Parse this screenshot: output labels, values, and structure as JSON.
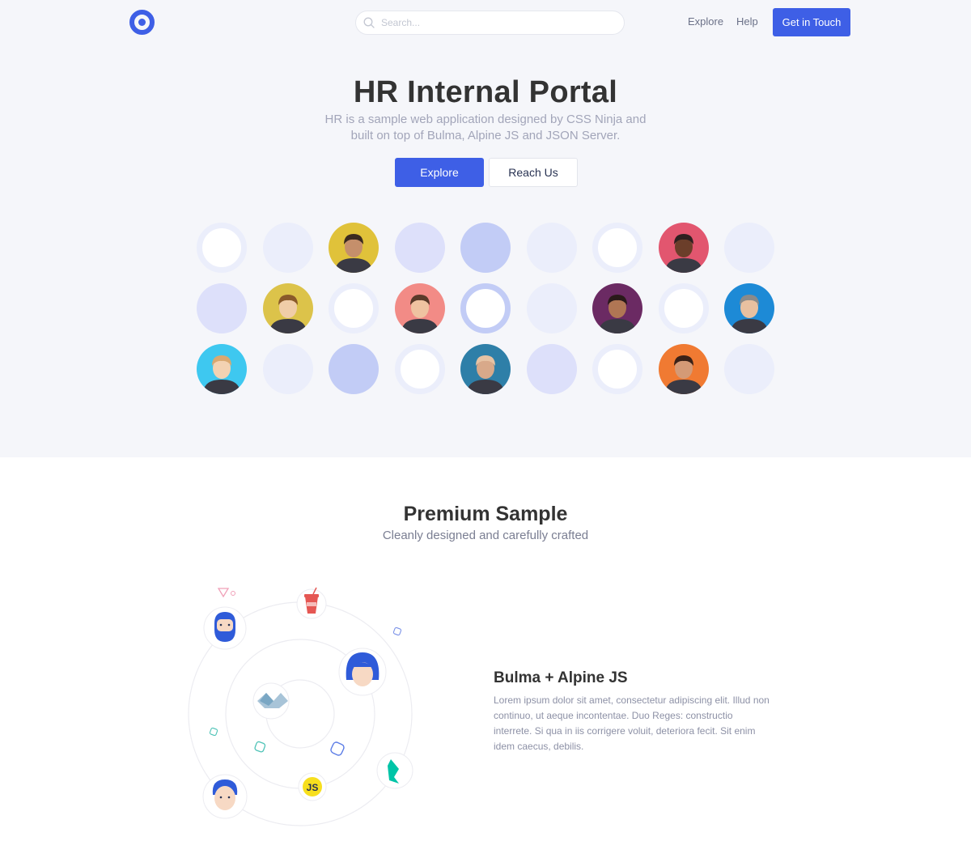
{
  "navbar": {
    "logo_icon": "target-ring-logo",
    "search": {
      "placeholder": "Search...",
      "icon": "search-icon"
    },
    "links": [
      "Explore",
      "Help"
    ],
    "cta": "Get in Touch",
    "accent": "#3e5fe6"
  },
  "hero": {
    "title": "HR Internal Portal",
    "subtitle": "HR is a sample web application designed by CSS Ninja and built on top of Bulma, Alpine JS and JSON Server.",
    "primary_button": "Explore",
    "secondary_button": "Reach Us",
    "background": "#f5f6fa",
    "avatar_grid": [
      [
        "ring",
        "light",
        "photo",
        "lavender",
        "blue",
        "light",
        "ring",
        "photo",
        "light"
      ],
      [
        "lavender",
        "photo",
        "ring",
        "photo",
        "ring-blue",
        "light",
        "photo",
        "ring",
        "photo"
      ],
      [
        "photo",
        "light",
        "blue",
        "ring",
        "photo",
        "lavender",
        "ring",
        "photo",
        "light"
      ]
    ]
  },
  "section": {
    "title": "Premium Sample",
    "subtitle": "Cleanly designed and carefully crafted",
    "feature": {
      "title": "Bulma + Alpine JS",
      "text": "Lorem ipsum dolor sit amet, consectetur adipiscing elit. Illud non continuo, ut aeque incontentae. Duo Reges: constructio interrete. Si qua in iis corrigere voluit, deteriora fecit. Sit enim idem caecus, debilis."
    },
    "illustration_badges": [
      "bearded-user-avatar",
      "soda-cup-icon",
      "woman-user-avatar",
      "vue-logo",
      "js-logo",
      "bulma-logo",
      "man-user-avatar"
    ],
    "js_badge": "JS"
  }
}
